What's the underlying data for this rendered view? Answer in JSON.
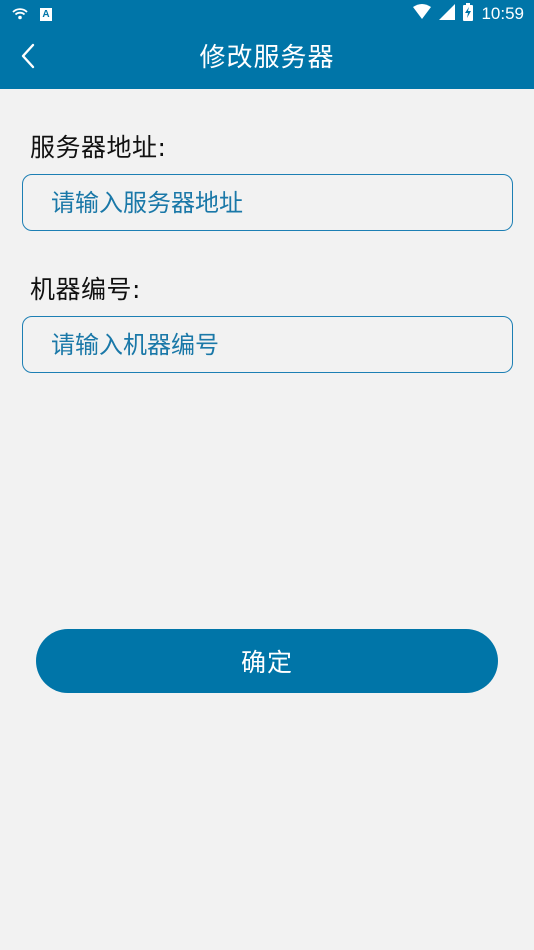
{
  "status_bar": {
    "time": "10:59",
    "badge": "A",
    "icons": [
      "wifi-icon",
      "notification-a-icon",
      "wifi-signal-icon",
      "cell-signal-icon",
      "battery-charging-icon"
    ]
  },
  "app_bar": {
    "title": "修改服务器",
    "back_icon": "chevron-left-icon"
  },
  "form": {
    "server_address": {
      "label": "服务器地址:",
      "value": "",
      "placeholder": "请输入服务器地址"
    },
    "machine_number": {
      "label": "机器编号:",
      "value": "",
      "placeholder": "请输入机器编号"
    }
  },
  "confirm_button": {
    "label": "确定"
  },
  "colors": {
    "primary": "#0075a8",
    "background": "#f2f2f2",
    "input_border": "#1d7fb4",
    "placeholder": "#1a78a8",
    "label_text": "#111111"
  }
}
